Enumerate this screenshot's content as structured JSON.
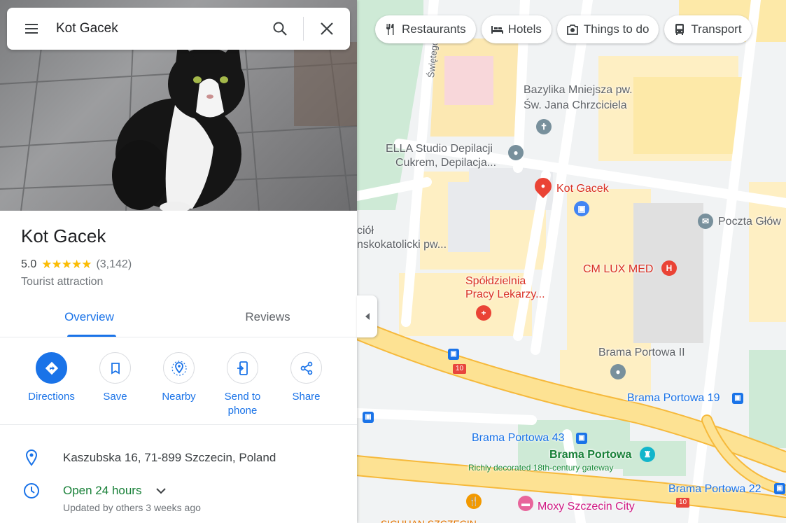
{
  "search": {
    "query": "Kot Gacek"
  },
  "place": {
    "title": "Kot Gacek",
    "rating": "5.0",
    "stars": "★★★★★",
    "review_count": "(3,142)",
    "category": "Tourist attraction"
  },
  "tabs": [
    {
      "label": "Overview",
      "active": true
    },
    {
      "label": "Reviews",
      "active": false
    }
  ],
  "actions": [
    {
      "label": "Directions",
      "icon": "directions-icon"
    },
    {
      "label": "Save",
      "icon": "bookmark-icon"
    },
    {
      "label": "Nearby",
      "icon": "nearby-icon"
    },
    {
      "label": "Send to phone",
      "icon": "send-to-phone-icon"
    },
    {
      "label": "Share",
      "icon": "share-icon"
    }
  ],
  "info": {
    "address": "Kaszubska 16, 71-899 Szczecin, Poland",
    "hours_status": "Open 24 hours",
    "hours_updated": "Updated by others 3 weeks ago"
  },
  "chips": [
    {
      "label": "Restaurants",
      "icon": "fork-knife-icon"
    },
    {
      "label": "Hotels",
      "icon": "bed-icon"
    },
    {
      "label": "Things to do",
      "icon": "camera-icon"
    },
    {
      "label": "Transport",
      "icon": "bus-icon"
    }
  ],
  "map": {
    "labels": {
      "street_swietego": "Świętego Woj",
      "bazylika_1": "Bazylika Mniejsza pw.",
      "bazylika_2": "Św. Jana Chrzciciela",
      "ella_1": "ELLA Studio Depilacji",
      "ella_2": "Cukrem, Depilacja...",
      "kot_gacek": "Kot Gacek",
      "poczta": "Poczta Głów",
      "kosciol_1": "ciół",
      "kosciol_2": "nskokatolicki pw...",
      "cm_lux": "CM LUX MED",
      "spoldzielnia_1": "Spółdzielnia",
      "spoldzielnia_2": "Pracy Lekarzy...",
      "brama_ii": "Brama Portowa II",
      "brama_19": "Brama Portowa 19",
      "brama_43": "Brama Portowa 43",
      "brama_portowa": "Brama Portowa",
      "brama_desc": "Richly decorated 18th-century gateway",
      "brama_22": "Brama Portowa 22",
      "moxy": "Moxy Szczecin City",
      "sichuan": "SICHUAN SZCZECIN",
      "route_10a": "10",
      "route_10b": "10"
    },
    "colors": {
      "road_major": "#fde293",
      "road_outline": "#f9c74f",
      "building": "#feefc3",
      "park": "#ceead6",
      "pin_red": "#ea4335",
      "accent_blue": "#1a73e8"
    }
  }
}
